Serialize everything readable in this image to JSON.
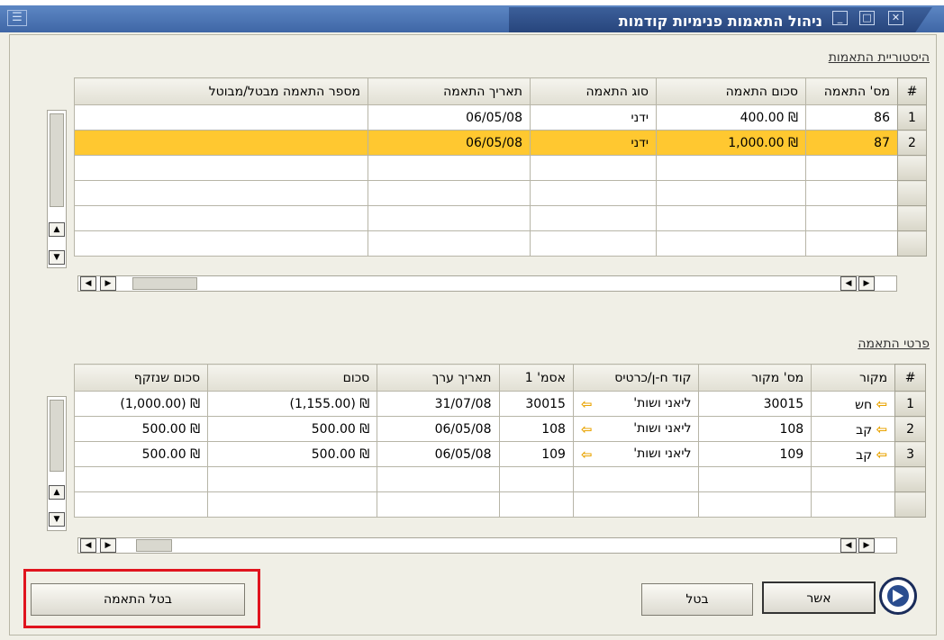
{
  "window": {
    "title": "ניהול התאמות פנימיות קודמות",
    "menu_icon": "menu-icon",
    "controls": {
      "close": "close-icon",
      "maximize": "maximize-icon",
      "minimize": "minimize-icon"
    }
  },
  "history": {
    "title": "היסטוריית התאמות",
    "columns": [
      "#",
      "מס' התאמה",
      "סכום התאמה",
      "סוג התאמה",
      "תאריך התאמה",
      "מספר התאמה מבטל/מבוטל"
    ],
    "rows": [
      {
        "num": "1",
        "match_no": "86",
        "amount": "₪ 400.00",
        "type": "ידני",
        "date": "06/05/08",
        "cancel_no": ""
      },
      {
        "num": "2",
        "match_no": "87",
        "amount": "₪ 1,000.00",
        "type": "ידני",
        "date": "06/05/08",
        "cancel_no": ""
      }
    ],
    "selected_row": 2
  },
  "details": {
    "title": "פרטי התאמה",
    "columns": [
      "#",
      "מקור",
      "מס' מקור",
      "קוד ח-ן/כרטיס",
      "אסמ' 1",
      "תאריך ערך",
      "סכום",
      "סכום שנזקף"
    ],
    "rows": [
      {
        "num": "1",
        "source": "חש",
        "source_no": "30015",
        "account": "ליאני ושות'",
        "ref1": "30015",
        "value_date": "31/07/08",
        "amount": "₪ (1,155.00)",
        "applied": "₪ (1,000.00)"
      },
      {
        "num": "2",
        "source": "קב",
        "source_no": "108",
        "account": "ליאני ושות'",
        "ref1": "108",
        "value_date": "06/05/08",
        "amount": "₪ 500.00",
        "applied": "₪ 500.00"
      },
      {
        "num": "3",
        "source": "קב",
        "source_no": "109",
        "account": "ליאני ושות'",
        "ref1": "109",
        "value_date": "06/05/08",
        "amount": "₪ 500.00",
        "applied": "₪ 500.00"
      }
    ]
  },
  "buttons": {
    "ok": "אשר",
    "cancel": "בטל",
    "cancel_match": "בטל התאמה"
  },
  "colors": {
    "selection": "#ffc830",
    "highlight_frame": "#e0141e",
    "titlebar": "#3f66a6"
  }
}
